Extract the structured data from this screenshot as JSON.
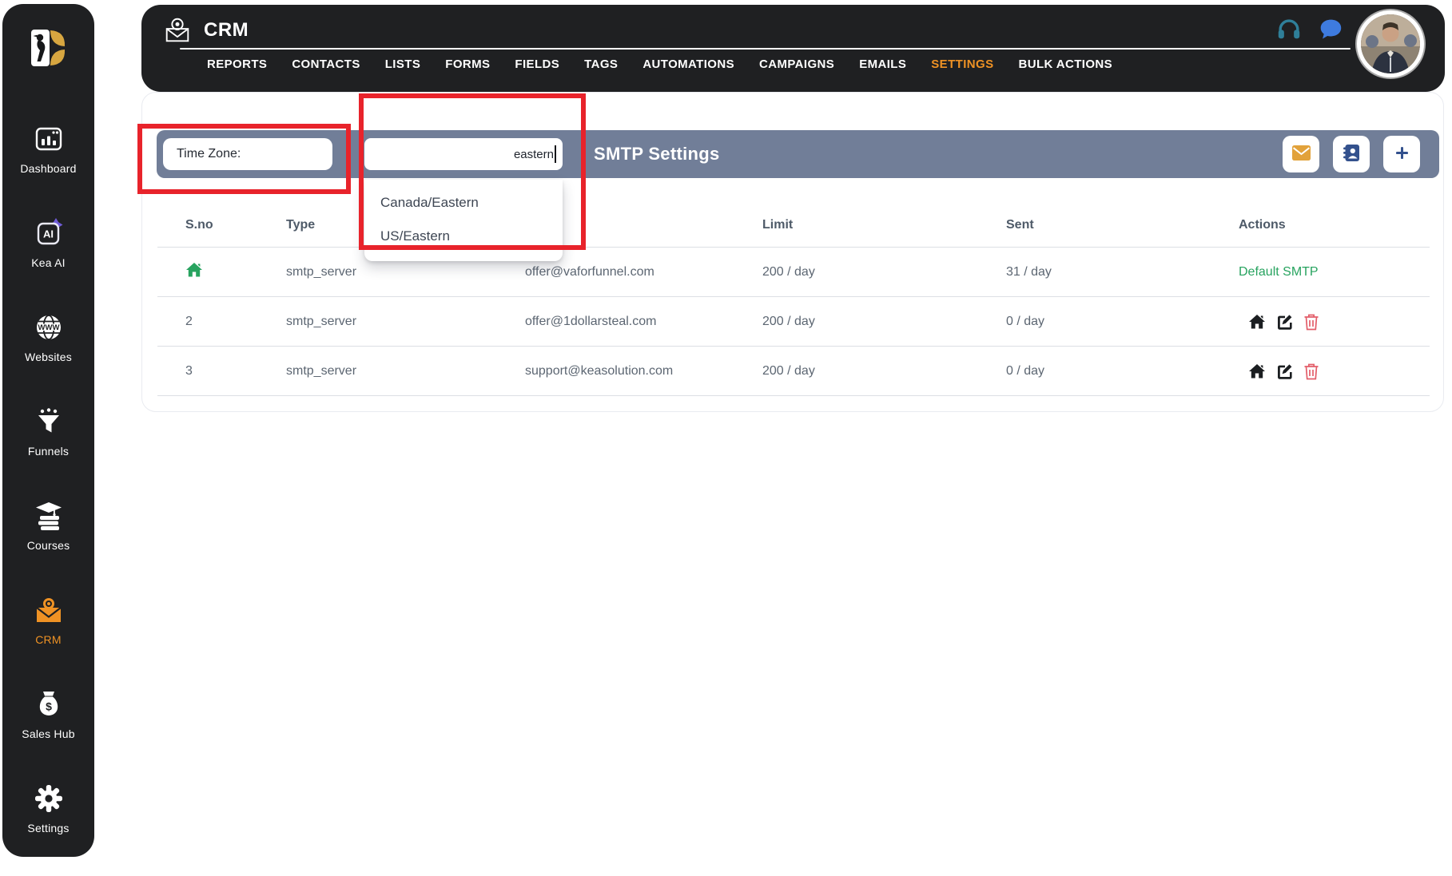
{
  "sidebar": {
    "items": [
      {
        "id": "dashboard",
        "label": "Dashboard",
        "icon": "dashboard-icon",
        "active": false
      },
      {
        "id": "kea-ai",
        "label": "Kea AI",
        "icon": "kea-ai-icon",
        "active": false
      },
      {
        "id": "websites",
        "label": "Websites",
        "icon": "websites-icon",
        "active": false
      },
      {
        "id": "funnels",
        "label": "Funnels",
        "icon": "funnels-icon",
        "active": false
      },
      {
        "id": "courses",
        "label": "Courses",
        "icon": "courses-icon",
        "active": false
      },
      {
        "id": "crm",
        "label": "CRM",
        "icon": "crm-envelope-gear-icon",
        "active": true
      },
      {
        "id": "sales-hub",
        "label": "Sales Hub",
        "icon": "money-bag-icon",
        "active": false
      },
      {
        "id": "settings",
        "label": "Settings",
        "icon": "gear-icon",
        "active": false
      }
    ]
  },
  "topbar": {
    "title": "CRM",
    "nav": [
      {
        "id": "reports",
        "label": "REPORTS",
        "active": false
      },
      {
        "id": "contacts",
        "label": "CONTACTS",
        "active": false
      },
      {
        "id": "lists",
        "label": "LISTS",
        "active": false
      },
      {
        "id": "forms",
        "label": "FORMS",
        "active": false
      },
      {
        "id": "fields",
        "label": "FIELDS",
        "active": false
      },
      {
        "id": "tags",
        "label": "TAGS",
        "active": false
      },
      {
        "id": "automations",
        "label": "AUTOMATIONS",
        "active": false
      },
      {
        "id": "campaigns",
        "label": "CAMPAIGNS",
        "active": false
      },
      {
        "id": "emails",
        "label": "EMAILS",
        "active": false
      },
      {
        "id": "settings",
        "label": "SETTINGS",
        "active": true
      },
      {
        "id": "bulk-actions",
        "label": "BULK ACTIONS",
        "active": false
      }
    ]
  },
  "toolbar": {
    "timezone_label": "Time Zone:",
    "timezone_value": "eastern",
    "title": "SMTP Settings",
    "buttons": [
      {
        "id": "email-button",
        "icon": "envelope-icon"
      },
      {
        "id": "address-book-button",
        "icon": "address-book-icon"
      },
      {
        "id": "add-smtp-button",
        "icon": "plus-icon"
      }
    ],
    "dropdown_options": [
      "Canada/Eastern",
      "US/Eastern"
    ]
  },
  "table": {
    "columns": [
      "S.no",
      "Type",
      "",
      "Limit",
      "Sent",
      "Actions"
    ],
    "rows": [
      {
        "sno": "",
        "sno_icon": "home-icon",
        "type": "smtp_server",
        "host": "offer@vaforfunnel.com",
        "limit": "200 / day",
        "sent": "31 / day",
        "action_text": "Default SMTP",
        "action_icons": []
      },
      {
        "sno": "2",
        "sno_icon": "",
        "type": "smtp_server",
        "host": "offer@1dollarsteal.com",
        "limit": "200 / day",
        "sent": "0 / day",
        "action_text": "",
        "action_icons": [
          "home-icon",
          "edit-icon",
          "delete-icon"
        ]
      },
      {
        "sno": "3",
        "sno_icon": "",
        "type": "smtp_server",
        "host": "support@keasolution.com",
        "limit": "200 / day",
        "sent": "0 / day",
        "action_text": "",
        "action_icons": [
          "home-icon",
          "edit-icon",
          "delete-icon"
        ]
      }
    ]
  },
  "colors": {
    "accent_orange": "#ef9224",
    "toolbar_gray": "#717e98",
    "success_green": "#27a35f",
    "danger_red": "#e35d69",
    "annotation_red": "#e8232b",
    "chat_blue": "#3e7bdf",
    "headphones_teal": "#2f7f99",
    "button_navy": "#33518d",
    "brand_gold": "#d7a640",
    "dark_bg": "#1f2022"
  }
}
